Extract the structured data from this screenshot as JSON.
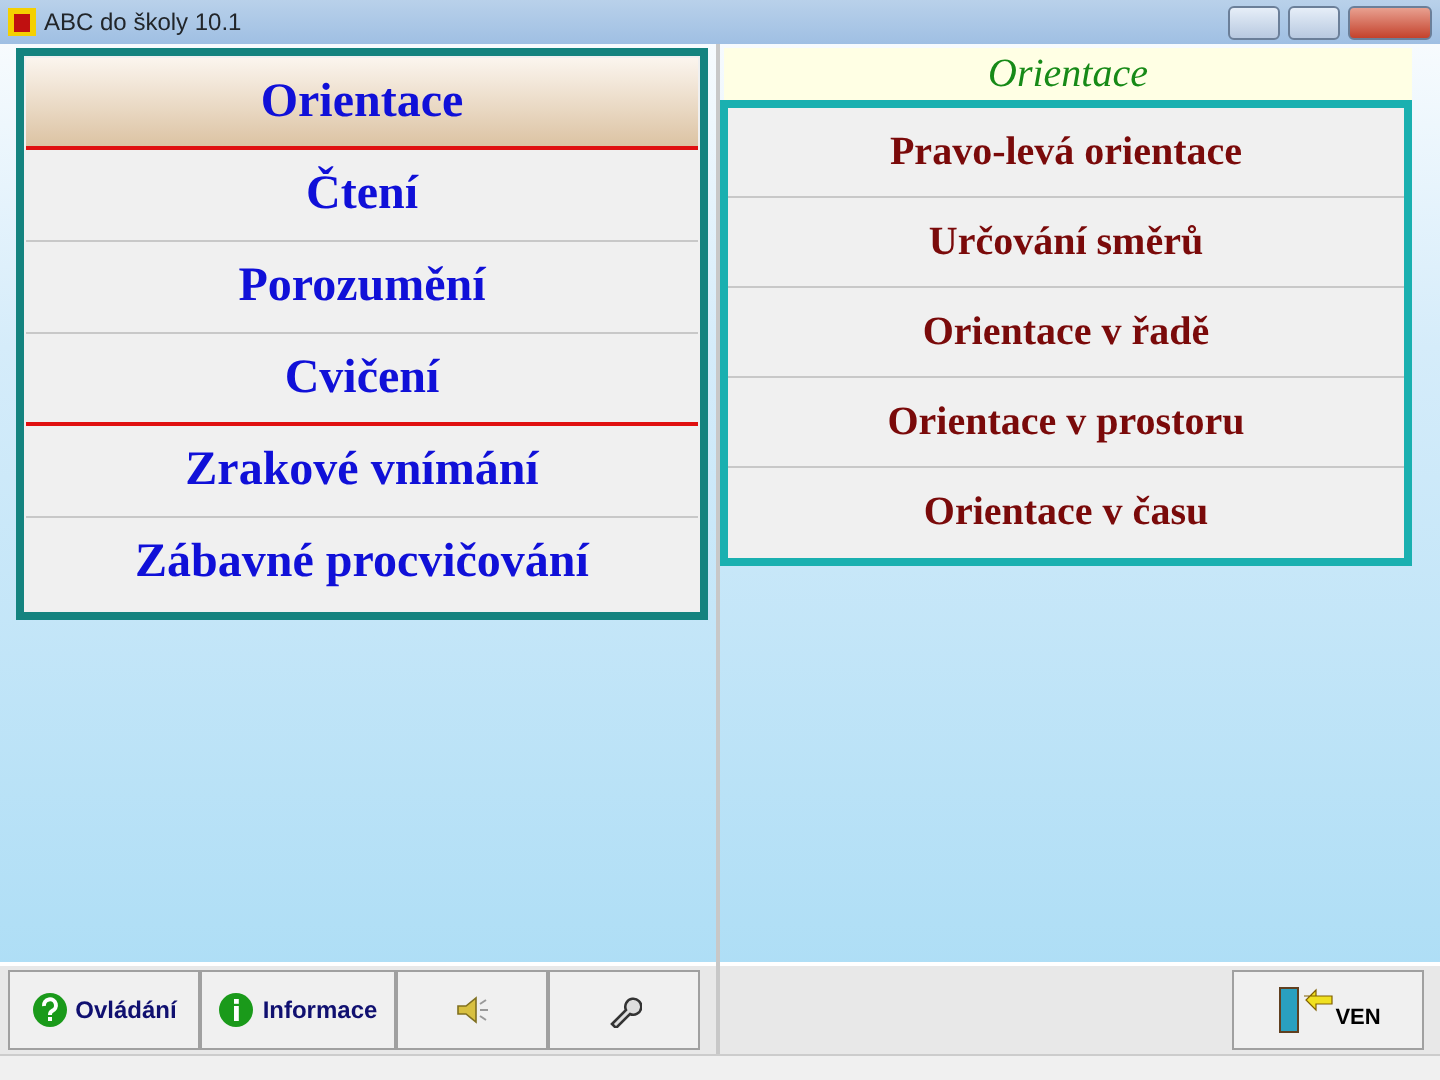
{
  "window": {
    "title": "ABC do školy 10.1"
  },
  "categories": [
    {
      "label": "Orientace",
      "selected": true,
      "divider_after": true
    },
    {
      "label": "Čtení",
      "selected": false,
      "divider_after": false
    },
    {
      "label": "Porozumění",
      "selected": false,
      "divider_after": false
    },
    {
      "label": "Cvičení",
      "selected": false,
      "divider_after": true
    },
    {
      "label": "Zrakové vnímání",
      "selected": false,
      "divider_after": false
    },
    {
      "label": "Zábavné procvičování",
      "selected": false,
      "divider_after": false
    }
  ],
  "exercises": {
    "heading": "Orientace",
    "items": [
      "Pravo-levá orientace",
      "Určování směrů",
      "Orientace v řadě",
      "Orientace v prostoru",
      "Orientace v času"
    ]
  },
  "toolbar": [
    {
      "kind": "help",
      "label": "Ovládání"
    },
    {
      "kind": "info",
      "label": "Informace"
    },
    {
      "kind": "sound"
    },
    {
      "kind": "settings"
    }
  ],
  "exit_button": {
    "label": "VEN"
  }
}
